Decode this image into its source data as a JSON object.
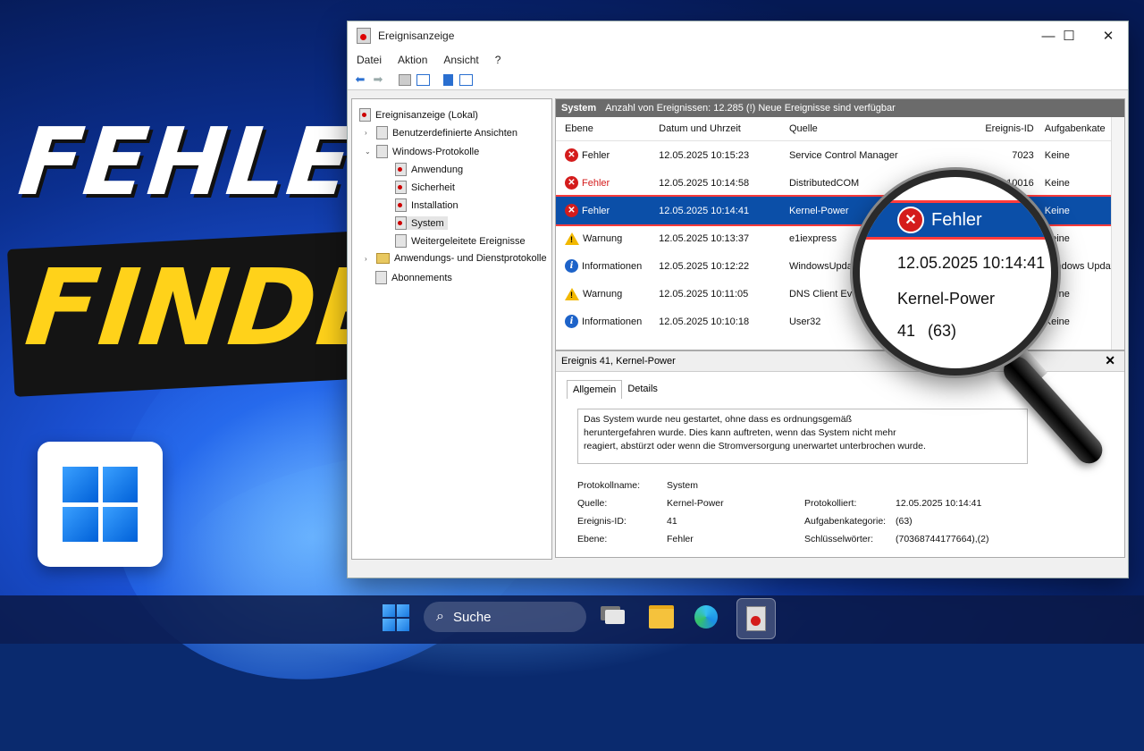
{
  "thumbnail": {
    "line1": "FEHLER",
    "line2": "FINDEN"
  },
  "window": {
    "title": "Ereignisanzeige",
    "controls": {
      "minimize": "—",
      "maximize": "☐",
      "close": "✕"
    },
    "menu": [
      "Datei",
      "Aktion",
      "Ansicht",
      "?"
    ]
  },
  "tree": {
    "root": "Ereignisanzeige (Lokal)",
    "custom": "Benutzerdefinierte Ansichten",
    "windows_logs": "Windows-Protokolle",
    "logs": [
      "Anwendung",
      "Sicherheit",
      "Installation",
      "System",
      "Weitergeleitete Ereignisse"
    ],
    "app_service": "Anwendungs- und Dienstprotokolle",
    "subscriptions": "Abonnements"
  },
  "list": {
    "log_name": "System",
    "summary": "Anzahl von Ereignissen: 12.285 (!) Neue Ereignisse sind verfügbar",
    "columns": [
      "Ebene",
      "Datum und Uhrzeit",
      "Quelle",
      "Ereignis-ID",
      "Aufgabenkate"
    ],
    "rows": [
      {
        "level": "Fehler",
        "type": "err",
        "datetime": "12.05.2025 10:15:23",
        "source": "Service Control Manager",
        "id": "7023",
        "task": "Keine"
      },
      {
        "level": "Fehler",
        "type": "err",
        "datetime": "12.05.2025 10:14:58",
        "source": "DistributedCOM",
        "id": "10016",
        "task": "Keine"
      },
      {
        "level": "Fehler",
        "type": "err",
        "datetime": "12.05.2025 10:14:41",
        "source": "Kernel-Power",
        "id": "",
        "task": "Keine"
      },
      {
        "level": "Warnung",
        "type": "warn",
        "datetime": "12.05.2025 10:13:37",
        "source": "e1iexpress",
        "id": "",
        "task": "Keine"
      },
      {
        "level": "Informationen",
        "type": "info",
        "datetime": "12.05.2025 10:12:22",
        "source": "WindowsUpdate",
        "id": "",
        "task": "Windows Update"
      },
      {
        "level": "Warnung",
        "type": "warn",
        "datetime": "12.05.2025 10:11:05",
        "source": "DNS Client Events",
        "id": "",
        "task": "Keine"
      },
      {
        "level": "Informationen",
        "type": "info",
        "datetime": "12.05.2025 10:10:18",
        "source": "User32",
        "id": "",
        "task": "Keine"
      }
    ]
  },
  "detail": {
    "title": "Ereignis 41, Kernel-Power",
    "tabs": [
      "Allgemein",
      "Details"
    ],
    "description_lines": [
      "Das System wurde neu gestartet, ohne dass es ordnungsgemäß",
      "heruntergefahren wurde. Dies kann auftreten, wenn das System nicht mehr",
      "reagiert, abstürzt oder wenn die Stromversorgung unerwartet unterbrochen wurde."
    ],
    "protokollname_label": "Protokollname:",
    "protokollname": "System",
    "quelle_label": "Quelle:",
    "quelle": "Kernel-Power",
    "protokolliert_label": "Protokolliert:",
    "protokolliert": "12.05.2025 10:14:41",
    "id_label": "Ereignis-ID:",
    "id": "41",
    "aufgabe_label": "Aufgabenkategorie:",
    "aufgabe": "(63)",
    "ebene_label": "Ebene:",
    "ebene": "Fehler",
    "schluessel_label": "Schlüsselwörter:",
    "schluessel": "(70368744177664),(2)"
  },
  "magnifier": {
    "level": "Fehler",
    "datetime": "12.05.2025 10:14:41",
    "source": "Kernel-Power",
    "id": "41",
    "task": "(63)"
  },
  "taskbar": {
    "search_label": "Suche"
  },
  "colors": {
    "selection": "#0b4fa8",
    "error": "#d41c1c",
    "warning": "#f2b800",
    "info": "#1d63c9",
    "title_yellow": "#ffd21a"
  }
}
